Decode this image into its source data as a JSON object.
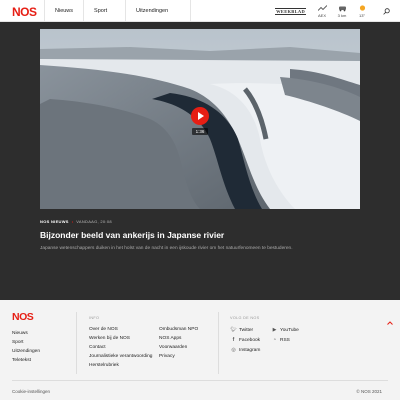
{
  "header": {
    "logo_n": "N",
    "logo_os": "OS",
    "nav": [
      "Nieuws",
      "Sport",
      "Uitzendingen"
    ],
    "weekblad": "WEEKBLAD",
    "widgets": [
      {
        "label": "AEX",
        "icon": "stock-chart-icon"
      },
      {
        "label": "3 km",
        "icon": "traffic-car-icon"
      },
      {
        "label": "13°",
        "icon": "weather-sun-icon"
      }
    ]
  },
  "video": {
    "duration": "1:36"
  },
  "article": {
    "source": "NOS NIEUWS",
    "date": "VANDAAG, 20:08",
    "title": "Bijzonder beeld van ankerijs in Japanse rivier",
    "description": "Japanse wetenschappers duiken in het holst van de nacht in een ijskoude rivier om het natuurfenomeen te bestuderen."
  },
  "footer": {
    "logo_n": "N",
    "logo_os": "OS",
    "nav": [
      "Nieuws",
      "Sport",
      "Uitzendingen",
      "Teletekst"
    ],
    "info_heading": "INFO",
    "info_col1": [
      "Over de NOS",
      "Werken bij de NOS",
      "Contact",
      "Journalistieke verantwoording",
      "Herstelrubriek"
    ],
    "info_col2": [
      "Ombudsman NPO",
      "NOS Apps",
      "Voorwaarden",
      "Privacy"
    ],
    "social_heading": "VOLG DE NOS",
    "social": {
      "twitter": "Twitter",
      "youtube": "YouTube",
      "facebook": "Facebook",
      "rss": "RSS",
      "instagram": "Instagram"
    },
    "cookie": "Cookie-instellingen",
    "copyright": "© NOS 2021"
  },
  "colors": {
    "brand_red": "#e61e14",
    "dark_bg": "#2d2d2d",
    "footer_bg": "#f3f3f3"
  }
}
